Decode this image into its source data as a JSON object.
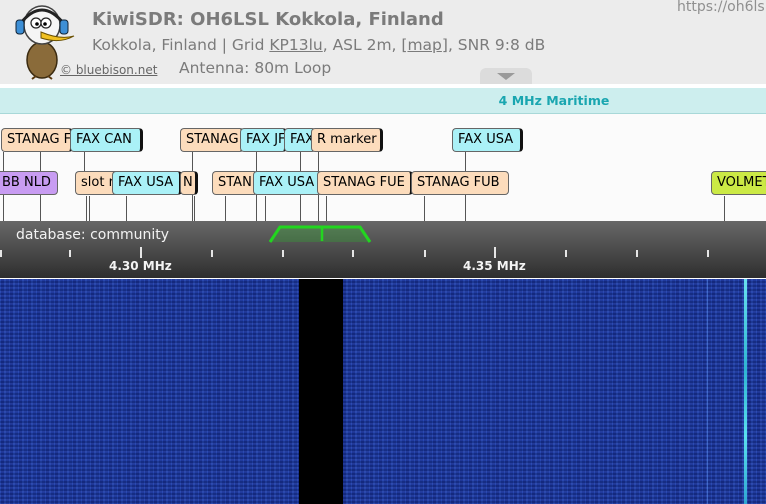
{
  "header": {
    "title": "KiwiSDR: OH6LSL Kokkola, Finland",
    "url": "https://oh6ls",
    "location": "Kokkola, Finland | Grid ",
    "grid": "KP13lu",
    "asl": ", ASL 2m, [",
    "map_link": "map",
    "snr": "], SNR 9:8 dB",
    "credit": "© bluebison.net",
    "antenna": "Antenna: 80m Loop"
  },
  "band_bar": {
    "name": "4 MHz Maritime"
  },
  "labels": [
    {
      "text": "STANAG F",
      "category": "utility"
    },
    {
      "text": "FAX CAN",
      "category": "fax"
    },
    {
      "text": "STANAG",
      "category": "utility"
    },
    {
      "text": "FAX JF",
      "category": "fax"
    },
    {
      "text": "FAX",
      "category": "fax"
    },
    {
      "text": "R marker",
      "category": "utility"
    },
    {
      "text": "FAX USA",
      "category": "fax"
    },
    {
      "text": "BB NLD",
      "category": "broadcast"
    },
    {
      "text": "slot r",
      "category": "utility"
    },
    {
      "text": "FAX USA",
      "category": "fax"
    },
    {
      "text": "N",
      "category": "utility"
    },
    {
      "text": "STAN",
      "category": "utility"
    },
    {
      "text": "FAX USA",
      "category": "fax"
    },
    {
      "text": "STANAG FUE",
      "category": "utility"
    },
    {
      "text": "STANAG FUB",
      "category": "utility"
    },
    {
      "text": "VOLMET",
      "category": "aero"
    }
  ],
  "scale": {
    "database_label": "database: community",
    "freq_labels": [
      "4.30 MHz",
      "4.35 MHz"
    ]
  },
  "colors": {
    "utility": "#fcdcbc",
    "fax": "#aaf1f7",
    "broadcast": "#c89cf2",
    "aero": "#cbe945",
    "passband": "#22d61f",
    "band_bar": "#cdeeee",
    "band_text": "#1aa6b0"
  }
}
